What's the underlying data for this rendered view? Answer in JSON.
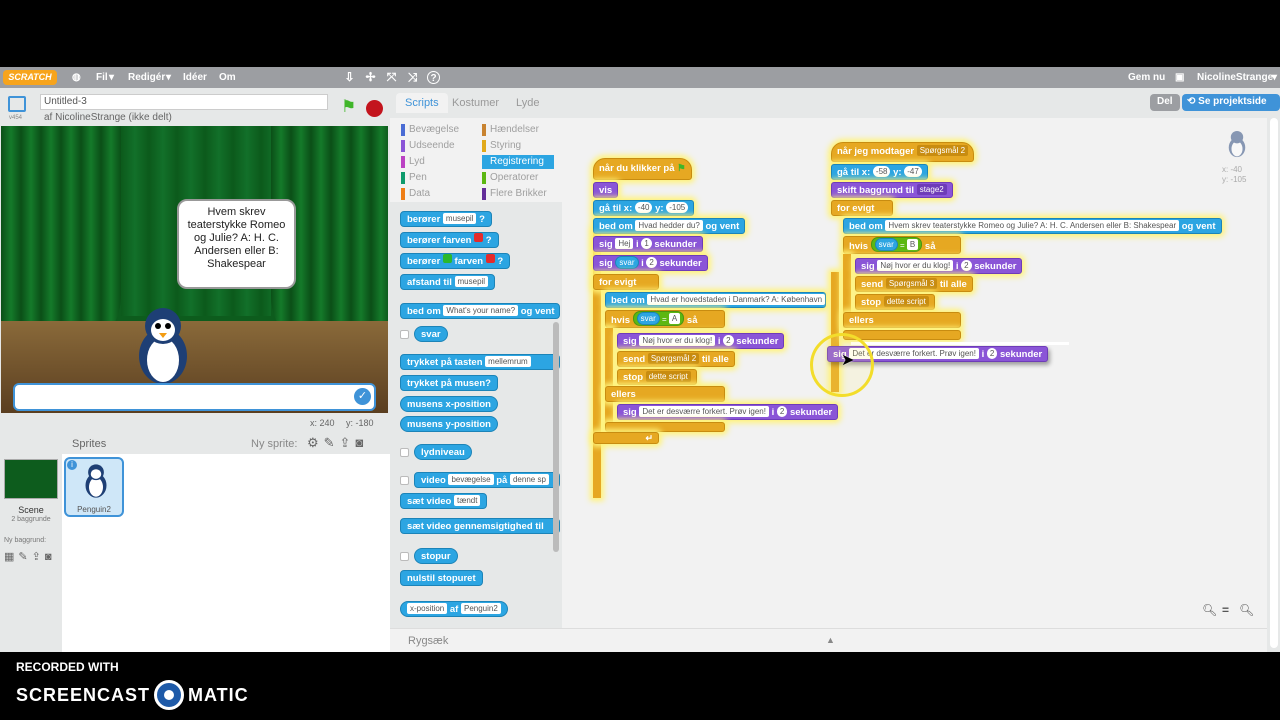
{
  "menu": {
    "logo": "SCRATCH",
    "items": [
      "Fil",
      "Redigér",
      "Idéer",
      "Om"
    ],
    "gem": "Gem nu",
    "user": "NicolineStrange"
  },
  "stagehdr": {
    "title": "Untitled-3",
    "version": "v454",
    "author": "af NicolineStrange (ikke delt)"
  },
  "stage": {
    "bubble_text": "Hvem skrev teaterstykke Romeo og Julie? A: H. C. Andersen eller B: Shakespear",
    "coords_x": "x: 240",
    "coords_y": "y: -180"
  },
  "sprites": {
    "header": "Sprites",
    "new_sprite": "Ny sprite:",
    "scene_label": "Scene",
    "scene_sub": "2 baggrunde",
    "new_bg": "Ny baggrund:",
    "sprite_name": "Penguin2",
    "info": "i"
  },
  "tabs": [
    "Scripts",
    "Kostumer",
    "Lyde"
  ],
  "share": {
    "del": "Del",
    "project": "Se projektside"
  },
  "categories": [
    {
      "label": "Bevægelse",
      "color": "#4a6cd4"
    },
    {
      "label": "Hændelser",
      "color": "#c88330"
    },
    {
      "label": "Udseende",
      "color": "#8a55d7"
    },
    {
      "label": "Styring",
      "color": "#e1a91a"
    },
    {
      "label": "Lyd",
      "color": "#bb42c3"
    },
    {
      "label": "Registrering",
      "color": "#2ca5e2"
    },
    {
      "label": "Pen",
      "color": "#0e9a6c"
    },
    {
      "label": "Operatorer",
      "color": "#5cb712"
    },
    {
      "label": "Data",
      "color": "#ee7d16"
    },
    {
      "label": "Flere Brikker",
      "color": "#632d99"
    }
  ],
  "palette": {
    "b1": "berører",
    "b1s": "musepil",
    "b2": "berører farven",
    "b3a": "berører",
    "b3b": "farven",
    "b4": "afstand til",
    "b4s": "musepil",
    "ask": "bed om",
    "ask_field": "What's your name?",
    "ask_tail": "og vent",
    "answer": "svar",
    "key": "trykket på tasten",
    "key_s": "mellemrum",
    "mouse": "trykket på musen?",
    "mx": "musens x-position",
    "my": "musens y-position",
    "loud": "lydniveau",
    "video": "video",
    "video_s1": "bevægelse",
    "video_on": "på",
    "video_s2": "denne sp",
    "setvideo": "sæt video",
    "setvideo_s": "tændt",
    "transp": "sæt video gennemsigtighed til",
    "timer": "stopur",
    "reset": "nulstil stopuret",
    "of": "af",
    "of_s1": "x-position",
    "of_s2": "Penguin2"
  },
  "script1": {
    "hat": "når du klikker på",
    "show": "vis",
    "goto": "gå til x:",
    "x": "-40",
    "y_lbl": "y:",
    "y": "-105",
    "ask": "bed om",
    "ask_q": "Hvad hedder du?",
    "and_wait": "og vent",
    "say": "sig",
    "say1": "Hej",
    "i": "i",
    "n1": "1",
    "sec": "sekunder",
    "say2": "svar",
    "n2": "2",
    "forever": "for evigt",
    "ask2": "Hvad er hovedstaden i Danmark? A: København",
    "if": "hvis",
    "ans": "svar",
    "eq": "=",
    "A": "A",
    "then": "så",
    "sayok": "Nøj hvor er du klog!",
    "send": "send",
    "msg": "Spørgsmål 2",
    "to_all": "til alle",
    "stop": "stop",
    "stop_s": "dette script",
    "else": "ellers",
    "saybad": "Det er desværre forkert. Prøv igen!"
  },
  "script2": {
    "hat": "når jeg modtager",
    "msg": "Spørgsmål 2",
    "goto": "gå til x:",
    "x": "-58",
    "y_lbl": "y:",
    "y": "-47",
    "bg": "skift baggrund til",
    "bg_s": "stage2",
    "forever": "for evigt",
    "ask": "bed om",
    "q": "Hvem skrev teaterstykke Romeo og Julie? A: H. C. Andersen eller B: Shakespear",
    "and_wait": "og vent",
    "if": "hvis",
    "ans": "svar",
    "eq": "=",
    "B": "B",
    "then": "så",
    "say": "sig",
    "ok": "Nøj hvor er du klog!",
    "i": "i",
    "n": "2",
    "sec": "sekunder",
    "send": "send",
    "msg3": "Spørgsmål 3",
    "to_all": "til alle",
    "stop": "stop",
    "stop_s": "dette script",
    "else": "ellers",
    "dragged_say": "sig",
    "bad": "Det er desværre forkert. Prøv igen!"
  },
  "sprite_info": {
    "x": "x: -40",
    "y": "y: -105"
  },
  "footer": {
    "backpack": "Rygsæk"
  },
  "watermark": {
    "line1": "RECORDED WITH",
    "brand1": "SCREENCAST",
    "brand2": "MATIC"
  }
}
